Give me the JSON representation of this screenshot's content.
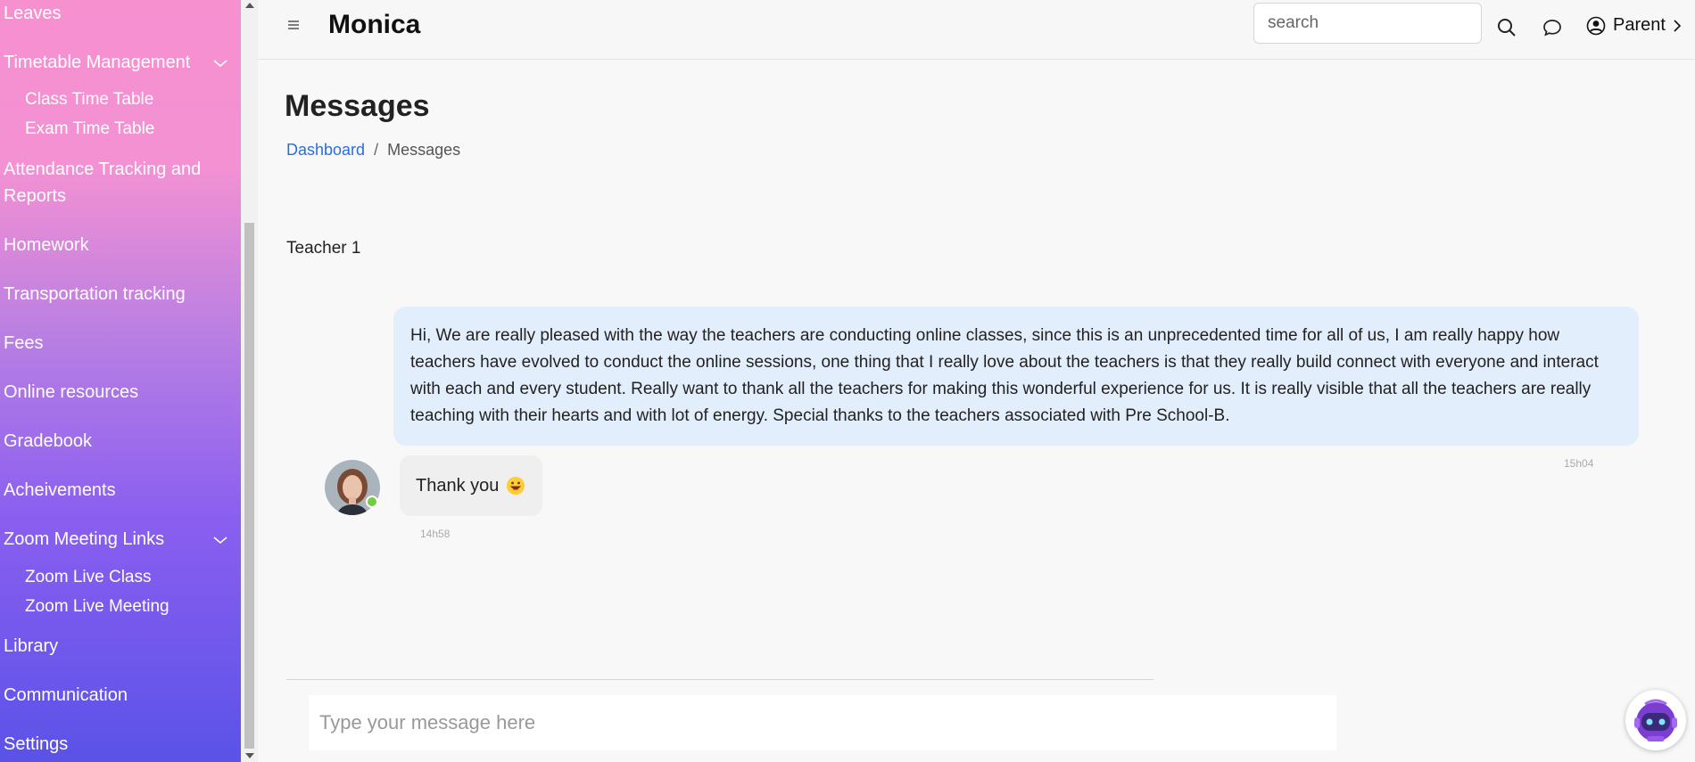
{
  "app": {
    "brand": "Monica"
  },
  "header": {
    "search_placeholder": "search",
    "user_label": "Parent"
  },
  "sidebar": {
    "items": [
      {
        "label": "Leaves"
      },
      {
        "label": "Timetable Management"
      },
      {
        "label": "Class Time Table"
      },
      {
        "label": "Exam Time Table"
      },
      {
        "label": "Attendance Tracking and"
      },
      {
        "label": "Reports"
      },
      {
        "label": "Homework"
      },
      {
        "label": "Transportation tracking"
      },
      {
        "label": "Fees"
      },
      {
        "label": "Online resources"
      },
      {
        "label": "Gradebook"
      },
      {
        "label": "Acheivements"
      },
      {
        "label": "Zoom Meeting Links"
      },
      {
        "label": "Zoom Live Class"
      },
      {
        "label": "Zoom Live Meeting"
      },
      {
        "label": "Library"
      },
      {
        "label": "Communication"
      },
      {
        "label": "Settings"
      }
    ]
  },
  "page": {
    "title": "Messages",
    "breadcrumb": {
      "home": "Dashboard",
      "separator": "/",
      "current": "Messages"
    }
  },
  "chat": {
    "contact_name": "Teacher 1",
    "messages": [
      {
        "text": "Hi, We are really pleased with the way the teachers are conducting online classes, since this is an unprecedented time for all of us, I am really happy how teachers have evolved to conduct the online sessions, one thing that I really love about the teachers is that they really build connect with everyone and interact with each and every student. Really want to thank all the teachers for making this wonderful experience for us. It is really visible that all the teachers are really teaching with their hearts and with lot of energy. Special thanks to the teachers associated with Pre School-B.",
        "time": "15h04"
      },
      {
        "text": "Thank you",
        "time": "14h58"
      }
    ],
    "input_placeholder": "Type your message here"
  },
  "colors": {
    "link": "#2a6fdb",
    "outgoing_bubble": "#e3eefc",
    "incoming_bubble": "#efefef",
    "online": "#6fcf3e"
  }
}
